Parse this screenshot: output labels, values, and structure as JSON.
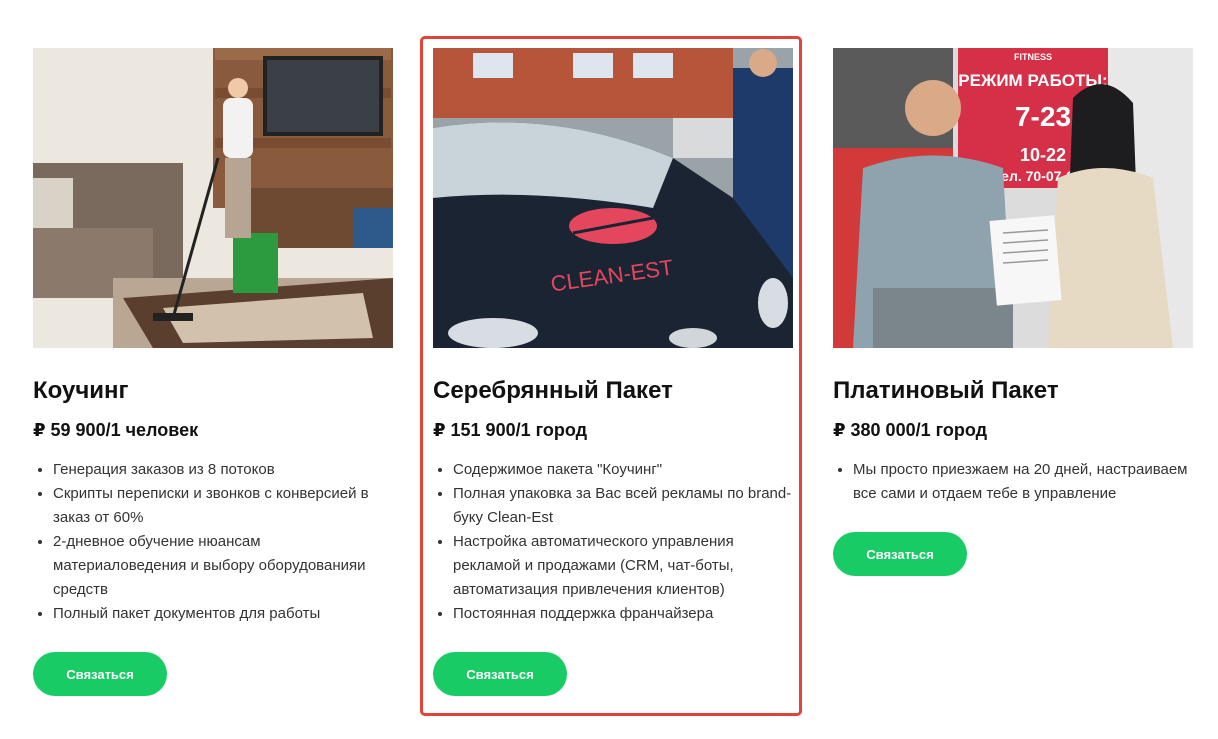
{
  "cards": [
    {
      "title": "Коучинг",
      "price": "₽ 59 900/1 человек",
      "features": [
        "Генерация заказов из 8 потоков",
        "Скрипты переписки и звонков с конверсией в заказ от 60%",
        "2-дневное обучение нюансам материаловедения и выбору оборудованияи средств",
        "Полный пакет документов для работы"
      ],
      "button_label": "Связаться",
      "image_icon": "photo-cleaning-living-room"
    },
    {
      "title": "Серебрянный Пакет",
      "price": "₽ 151 900/1 город",
      "features": [
        "Содержимое пакета \"Коучинг\"",
        "Полная упаковка за Вас всей рекламы по brand-буку Clean-Est",
        "Настройка автоматического управления рекламой и продажами (CRM, чат-боты, автоматизация привлечения клиентов)",
        "Постоянная поддержка франчайзера"
      ],
      "button_label": "Связаться",
      "image_icon": "photo-branded-car",
      "car_brand_text": "CLEAN-EST",
      "highlighted": true
    },
    {
      "title": "Платиновый Пакет",
      "price": "₽ 380 000/1 город",
      "features": [
        "Мы просто приезжаем на 20 дней, настраиваем все сами и отдаем тебе в управление"
      ],
      "button_label": "Связаться",
      "image_icon": "photo-fitness-contract",
      "sign": {
        "brand": "FITNESS",
        "heading": "РЕЖИМ РАБОТЫ:",
        "hours_weekday": "7-23",
        "hours_weekend": "10-22",
        "phone": "тел. 70-07-07"
      }
    }
  ],
  "colors": {
    "button": "#19cb64",
    "highlight_border": "#e0433a",
    "text": "#111111"
  }
}
